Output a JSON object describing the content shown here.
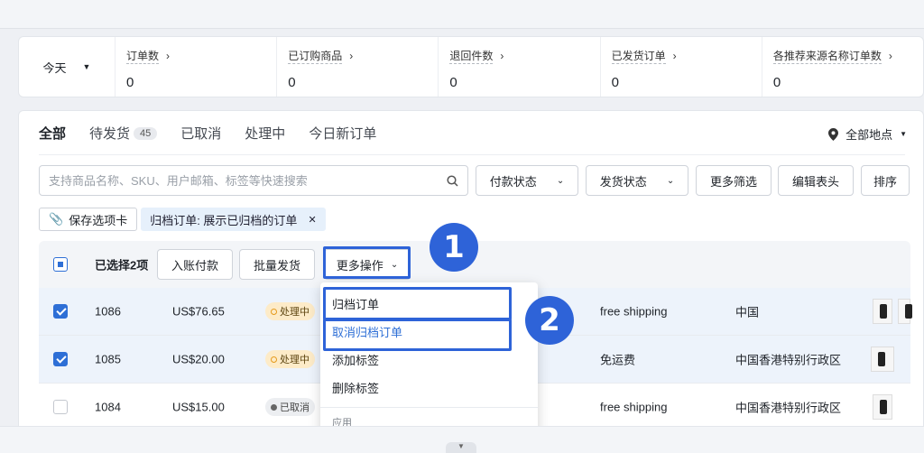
{
  "stats": {
    "period": "今天",
    "items": [
      {
        "label": "订单数",
        "value": "0"
      },
      {
        "label": "已订购商品",
        "value": "0"
      },
      {
        "label": "退回件数",
        "value": "0"
      },
      {
        "label": "已发货订单",
        "value": "0"
      },
      {
        "label": "各推荐来源名称订单数",
        "value": "0"
      }
    ]
  },
  "tabs": [
    {
      "label": "全部"
    },
    {
      "label": "待发货",
      "badge": "45"
    },
    {
      "label": "已取消"
    },
    {
      "label": "处理中"
    },
    {
      "label": "今日新订单"
    }
  ],
  "location": "全部地点",
  "search": {
    "placeholder": "支持商品名称、SKU、用户邮箱、标签等快速搜索"
  },
  "filters": {
    "payment": "付款状态",
    "shipping": "发货状态",
    "more": "更多筛选",
    "edit_header": "编辑表头",
    "sort": "排序"
  },
  "chips": {
    "save": "保存选项卡",
    "filter": "归档订单: 展示已归档的订单"
  },
  "bulk": {
    "selected": "已选择2项",
    "capture": "入账付款",
    "fulfill": "批量发货",
    "more": "更多操作"
  },
  "rows": [
    {
      "id": "1086",
      "amount": "US$76.65",
      "status": "处理中",
      "shipping": "free shipping",
      "region": "中国"
    },
    {
      "id": "1085",
      "amount": "US$20.00",
      "status": "处理中",
      "shipping": "免运费",
      "region": "中国香港特别行政区"
    },
    {
      "id": "1084",
      "amount": "US$15.00",
      "status": "已取消",
      "shipping": "free shipping",
      "region": "中国香港特别行政区"
    }
  ],
  "menu": {
    "archive": "归档订单",
    "unarchive": "取消归档订单",
    "add_tag": "添加标签",
    "remove_tag": "删除标签",
    "apps_group": "应用"
  },
  "callouts": {
    "one": "1",
    "two": "2"
  },
  "colors": {
    "accent": "#2e63d8",
    "processing_bg": "#fdebc8"
  }
}
